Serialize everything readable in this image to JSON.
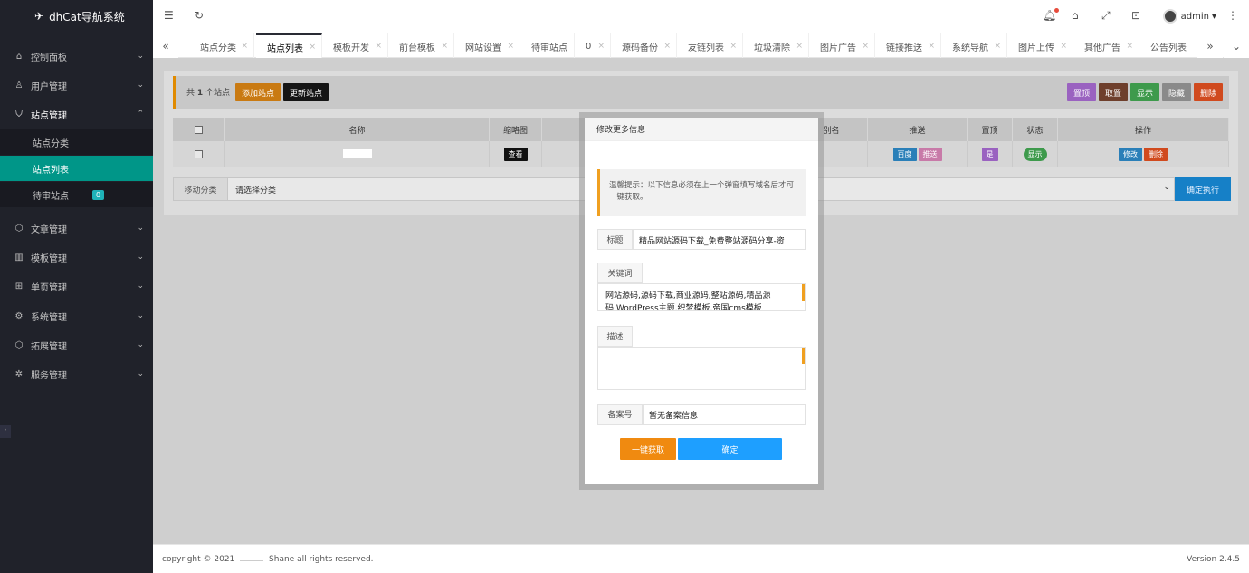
{
  "app": {
    "title": "dhCat导航系统",
    "logo_icon": "paper-plane-icon"
  },
  "sidebar": {
    "items": [
      {
        "label": "控制面板",
        "icon": "home-icon"
      },
      {
        "label": "用户管理",
        "icon": "user-icon"
      },
      {
        "label": "站点管理",
        "icon": "shield-icon"
      },
      {
        "label": "文章管理",
        "icon": "cube-icon"
      },
      {
        "label": "模板管理",
        "icon": "book-icon"
      },
      {
        "label": "单页管理",
        "icon": "app-icon"
      },
      {
        "label": "系统管理",
        "icon": "gear-icon"
      },
      {
        "label": "拓展管理",
        "icon": "cube-icon"
      },
      {
        "label": "服务管理",
        "icon": "settings-icon"
      }
    ],
    "sub_items": [
      {
        "label": "站点分类"
      },
      {
        "label": "站点列表"
      },
      {
        "label": "待审站点",
        "badge": "0"
      }
    ]
  },
  "header": {
    "user": "admin"
  },
  "tabs": [
    "站点分类",
    "站点列表",
    "模板开发",
    "前台模板",
    "网站设置",
    "待审站点",
    "0",
    "源码备份",
    "友链列表",
    "垃圾清除",
    "图片广告",
    "链接推送",
    "系统导航",
    "图片上传",
    "其他广告",
    "公告列表"
  ],
  "toolbar": {
    "count_prefix": "共",
    "count": "1",
    "count_suffix": "个站点",
    "add_label": "添加站点",
    "update_label": "更新站点",
    "top_label": "置顶",
    "untop_label": "取置",
    "show_label": "显示",
    "hide_label": "隐藏",
    "delete_label": "删除"
  },
  "table": {
    "headers": [
      "名称",
      "缩略图",
      "",
      "别名",
      "推送",
      "置顶",
      "状态",
      "操作"
    ],
    "row": {
      "thumb_btn": "查看",
      "push_baidu": "百度",
      "push_other": "推送",
      "top": "是",
      "status": "显示",
      "edit": "修改",
      "delete": "删除"
    }
  },
  "move": {
    "label": "移动分类",
    "placeholder": "请选择分类",
    "exec": "确定执行"
  },
  "footer": {
    "copyright": "copyright © 2021",
    "rights": "Shane all rights reserved.",
    "version": "Version 2.4.5"
  },
  "modal": {
    "title": "修改更多信息",
    "tip": "温馨提示：以下信息必须在上一个弹窗填写域名后才可一键获取。",
    "title_label": "标题",
    "title_value": "精品网站源码下载_免费整站源码分享-资",
    "keywords_label": "关键词",
    "keywords_value": "网站源码,源码下载,商业源码,整站源码,精品源码,WordPress主题,织梦模板,帝国cms模板",
    "desc_label": "描述",
    "icp_label": "备案号",
    "icp_value": "暂无备案信息",
    "fetch_label": "一键获取",
    "ok_label": "确定"
  },
  "colors": {
    "accent": "#009688",
    "sidebar_bg": "#20222a",
    "orange": "#f08a10",
    "blue": "#1e9fff"
  }
}
